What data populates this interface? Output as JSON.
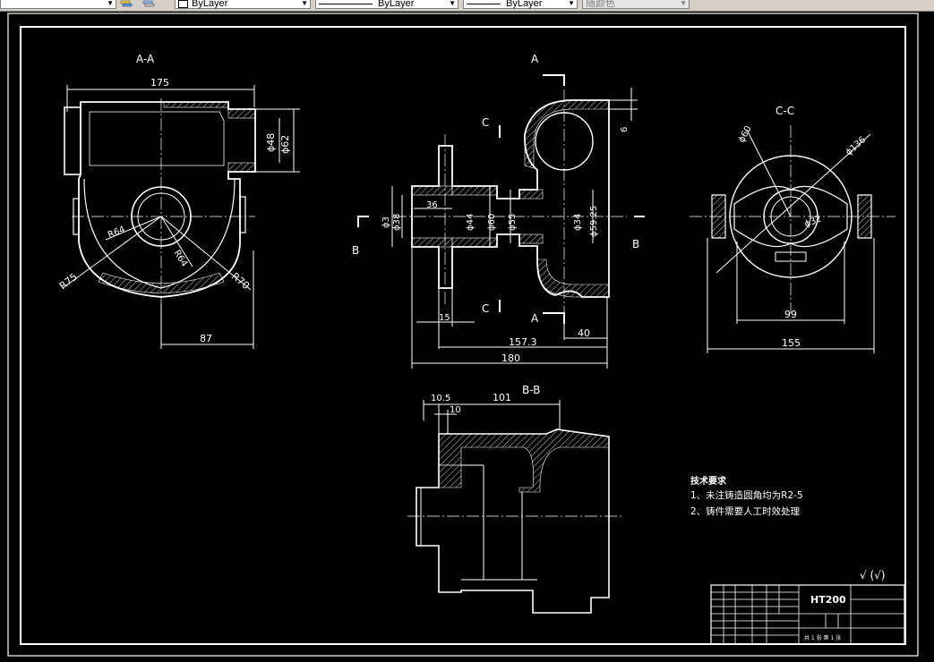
{
  "toolbar": {
    "layer_icon_1": "layer-stack-icon",
    "layer_icon_2": "layer-states-icon",
    "color_control": "ByLayer",
    "linetype_control": "ByLayer",
    "lineweight_control": "ByLayer",
    "plotstyle_control": "随颜色"
  },
  "drawing": {
    "views": {
      "aa_label": "A-A",
      "cc_label": "C-C",
      "bb_label": "B-B",
      "mark_a": "A",
      "mark_b": "B",
      "mark_c": "C"
    },
    "dims_aa": {
      "d175": "175",
      "d48": "ϕ48",
      "d62": "ϕ62",
      "r64a": "R64",
      "r64b": "R64",
      "r75": "R75",
      "r70": "R70",
      "d87": "87"
    },
    "dims_main": {
      "d3": "ϕ3",
      "d38": "ϕ38",
      "d36": "36",
      "d44": "ϕ44",
      "d60": "ϕ60",
      "d55": "ϕ55",
      "d34": "ϕ34",
      "d59_25": "ϕ59.25",
      "d6": "6",
      "d15": "15",
      "d40": "40",
      "d157_3": "157.3",
      "d180": "180"
    },
    "dims_cc": {
      "d60": "ϕ60",
      "d136": "ϕ136",
      "d32": "ϕ32",
      "d99": "99",
      "d155": "155"
    },
    "dims_bb": {
      "d10_5": "10.5",
      "d101": "101",
      "d10": "10"
    },
    "notes": {
      "title": "技术要求",
      "line1": "1、未注铸造圆角均为R2-5",
      "line2": "2、铸件需要人工时效处理"
    },
    "roughness": "√ (√)",
    "title_block": {
      "material": "HT200",
      "scale_row": "共 1 张    第 1 张"
    }
  }
}
